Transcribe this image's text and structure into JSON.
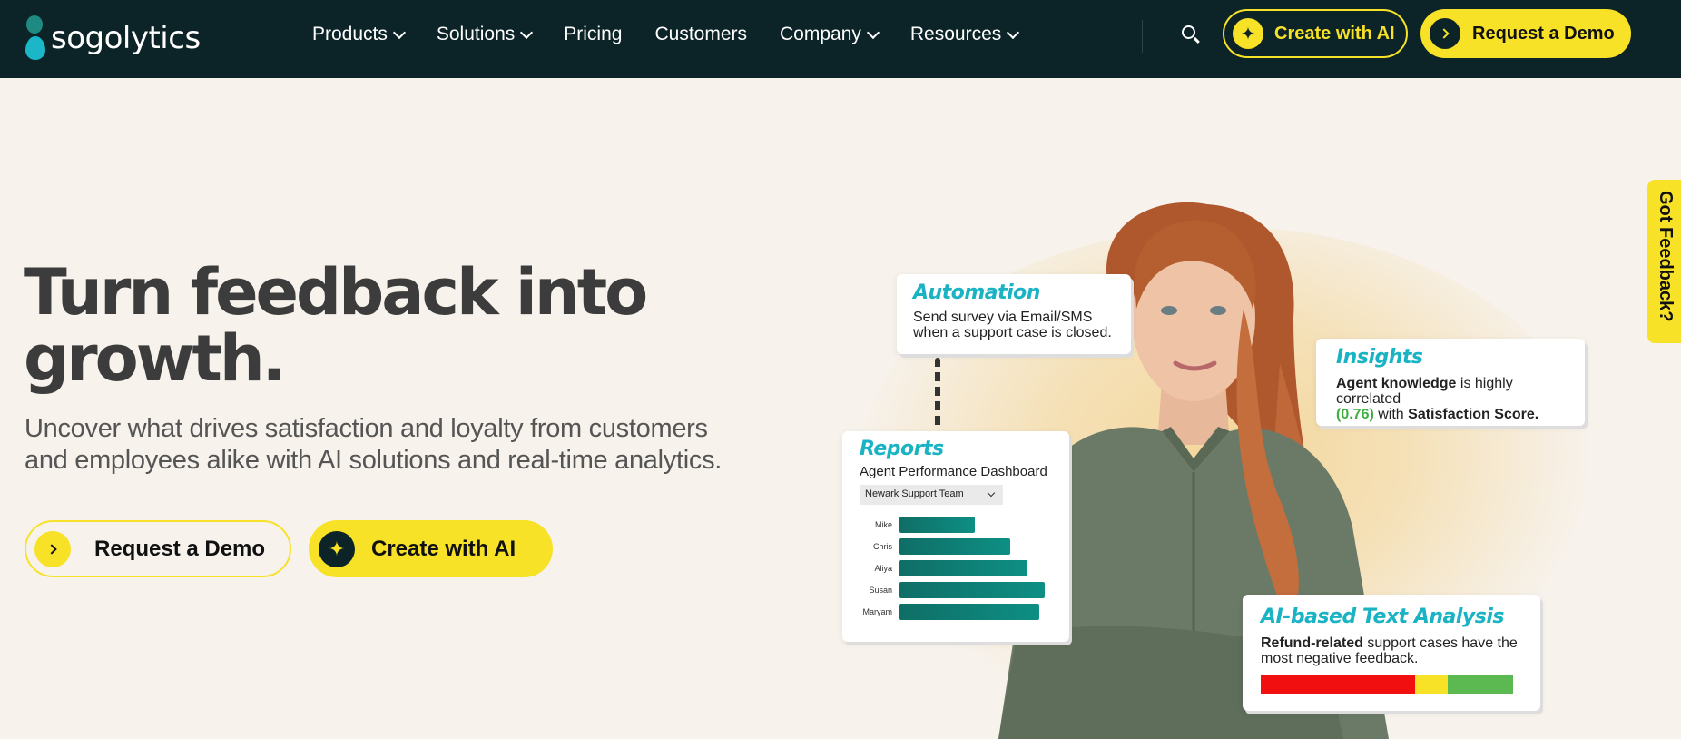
{
  "brand": {
    "name": "sogolytics"
  },
  "nav": {
    "items": [
      {
        "label": "Products",
        "has_dropdown": true
      },
      {
        "label": "Solutions",
        "has_dropdown": true
      },
      {
        "label": "Pricing",
        "has_dropdown": false
      },
      {
        "label": "Customers",
        "has_dropdown": false
      },
      {
        "label": "Company",
        "has_dropdown": true
      },
      {
        "label": "Resources",
        "has_dropdown": true
      }
    ],
    "search_icon": "search-icon",
    "create_ai_label": "Create with AI",
    "request_demo_label": "Request a Demo"
  },
  "hero": {
    "title_line1": "Turn feedback into",
    "title_line2": "growth.",
    "subtitle_line1": "Uncover what drives satisfaction and loyalty from customers",
    "subtitle_line2": "and employees alike with AI solutions and real-time analytics.",
    "request_demo_label": "Request a Demo",
    "create_ai_label": "Create with AI"
  },
  "cards": {
    "automation": {
      "title": "Automation",
      "line1": "Send survey via Email/SMS",
      "line2": "when a support case is closed."
    },
    "insights": {
      "title": "Insights",
      "bold1": "Agent knowledge",
      "text1": " is highly correlated",
      "value": "(0.76)",
      "text2": " with ",
      "bold2": "Satisfaction Score."
    },
    "reports": {
      "title": "Reports",
      "subtitle": "Agent Performance Dashboard",
      "dropdown": "Newark Support Team",
      "bars": [
        {
          "name": "Mike",
          "value": 0.52
        },
        {
          "name": "Chris",
          "value": 0.76
        },
        {
          "name": "Aliya",
          "value": 0.88
        },
        {
          "name": "Susan",
          "value": 1.0
        },
        {
          "name": "Maryam",
          "value": 0.96
        }
      ]
    },
    "text_analysis": {
      "title": "AI-based Text Analysis",
      "bold": "Refund-related",
      "text1": " support cases have the",
      "text2": "most negative feedback.",
      "sentiment": [
        {
          "label": "negative",
          "share": 0.61,
          "color": "#f10f0f"
        },
        {
          "label": "neutral",
          "share": 0.13,
          "color": "#f7e227"
        },
        {
          "label": "positive",
          "share": 0.26,
          "color": "#5cb951"
        }
      ]
    }
  },
  "feedback_tab": "Got Feedback?",
  "colors": {
    "nav_bg": "#0c2427",
    "accent": "#f7e227",
    "teal": "#19b3c4",
    "page_bg": "#f7f2ec"
  }
}
